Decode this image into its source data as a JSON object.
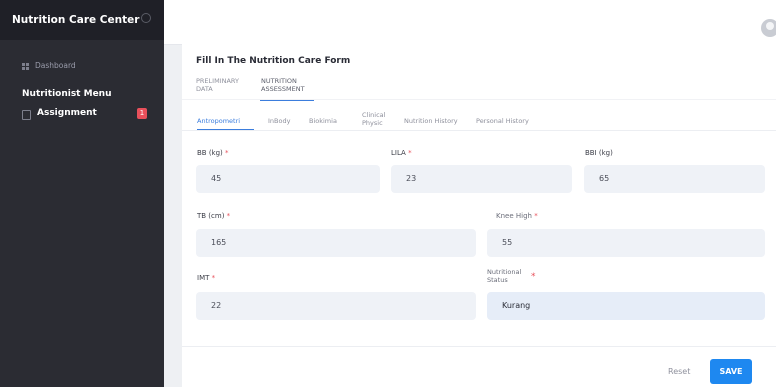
{
  "sidebar": {
    "brand": "Nutrition Care Center",
    "dashboard": "Dashboard",
    "menu_heading": "Nutritionist Menu",
    "assignment": "Assignment",
    "assignment_badge": "1"
  },
  "form": {
    "title": "Fill In The Nutrition Care Form",
    "top_tabs": [
      {
        "line1": "PRELIMINARY",
        "line2": "DATA"
      },
      {
        "line1": "NUTRITION",
        "line2": "ASSESSMENT"
      }
    ],
    "sub_tabs": {
      "antropometri": "Antropometri",
      "inbody": "InBody",
      "biokimia": "Biokimia",
      "clinical_line1": "Clinical",
      "clinical_line2": "Physic",
      "nutrition_history": "Nutrition History",
      "personal_history": "Personal History"
    },
    "fields": {
      "bb": {
        "label": "BB (kg)",
        "required": "*",
        "value": "45"
      },
      "lila": {
        "label": "LILA",
        "required": "*",
        "value": "23"
      },
      "bbi": {
        "label": "BBI (kg)",
        "value": "65"
      },
      "tb": {
        "label": "TB (cm)",
        "required": "*",
        "value": "165"
      },
      "knee": {
        "label": "Knee High",
        "required": "*",
        "value": "55"
      },
      "imt": {
        "label": "IMT",
        "required": "*",
        "value": "22"
      },
      "status": {
        "label_line1": "Nutritional",
        "label_line2": "Status",
        "required": "*",
        "value": "Kurang"
      }
    },
    "actions": {
      "reset": "Reset",
      "save": "SAVE"
    }
  }
}
